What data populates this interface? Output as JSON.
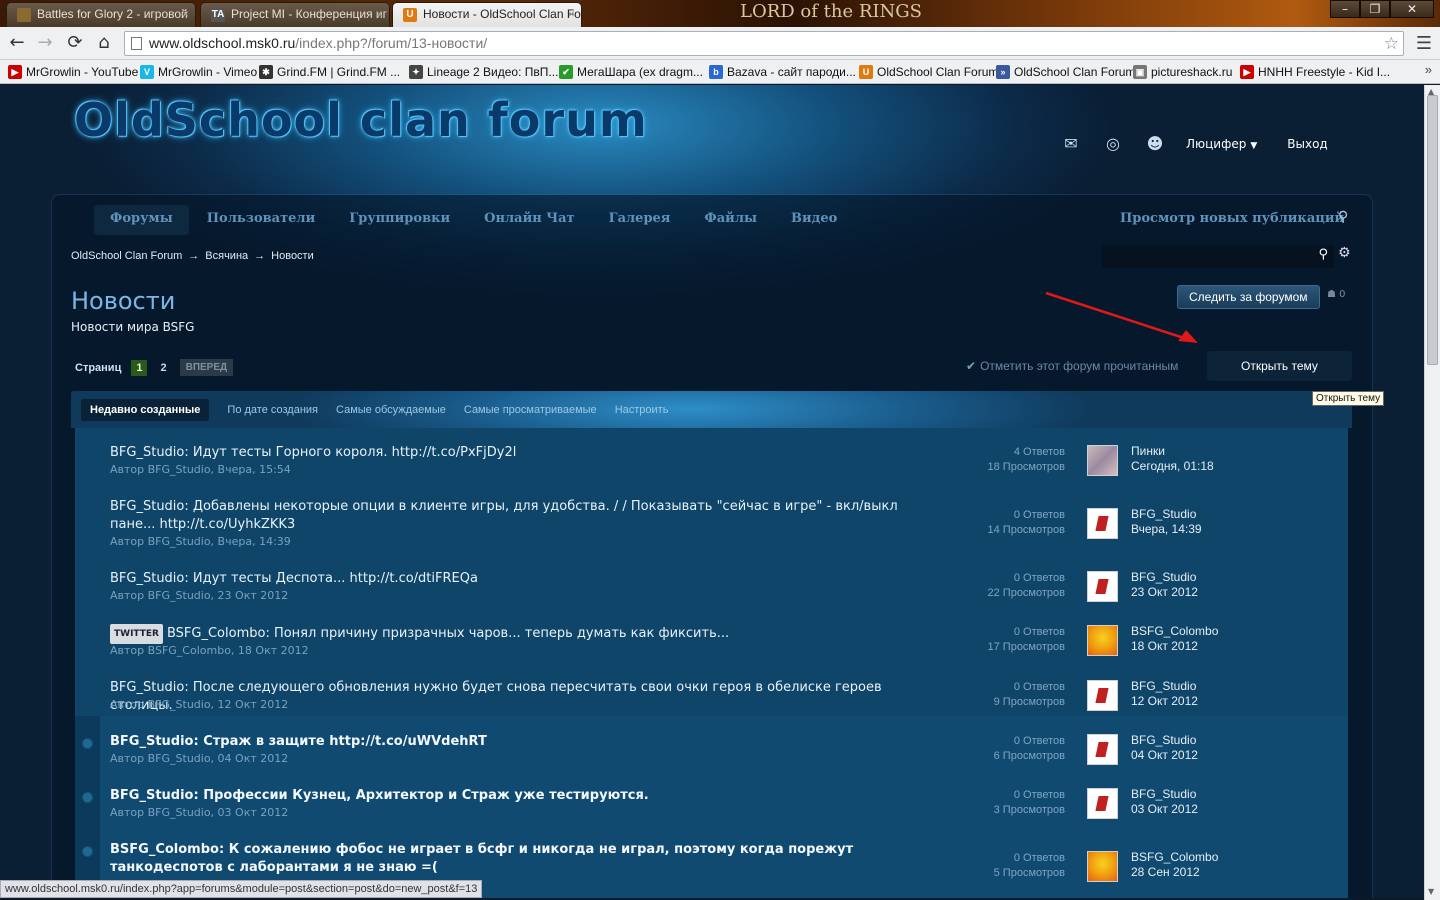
{
  "browser": {
    "tabs": [
      {
        "label": "Battles for Glory 2 - игровой",
        "icon_color": "#8a6a30",
        "active": false
      },
      {
        "label": "Project MI - Конференция иг",
        "icon_color": "#555555",
        "active": false
      },
      {
        "label": "Новости - OldSchool Clan For",
        "icon_color": "#e07a10",
        "active": true
      }
    ],
    "tab_icon_text": [
      "",
      "TA",
      "U"
    ],
    "theme_text": "LORD of the RINGS",
    "url_host": "www.oldschool.msk0.ru",
    "url_path": "/index.php?/forum/13-новости/",
    "bookmarks": [
      {
        "label": "MrGrowlin - YouTube",
        "icon": "youtube-icon",
        "color": "#cc0000"
      },
      {
        "label": "MrGrowlin - Vimeo",
        "icon": "vimeo-icon",
        "color": "#1ab7ea"
      },
      {
        "label": "Grind.FM | Grind.FM ...",
        "icon": "paw-icon",
        "color": "#333333"
      },
      {
        "label": "Lineage 2 Видео: ПвП...",
        "icon": "lineage-icon",
        "color": "#444444"
      },
      {
        "label": "МегаШара (ex dragm...",
        "icon": "check-icon",
        "color": "#2a9a2a"
      },
      {
        "label": "Bazava - сайт пароди...",
        "icon": "bazava-icon",
        "color": "#2a6ad0"
      },
      {
        "label": "OldSchool Clan Forum",
        "icon": "oldschool-icon",
        "color": "#e07a10"
      },
      {
        "label": "OldSchool Clan Forum",
        "icon": "double-arrow-icon",
        "color": "#3a5aa0"
      },
      {
        "label": "pictureshack.ru",
        "icon": "picture-icon",
        "color": "#777777"
      },
      {
        "label": "HNHH Freestyle - Kid I...",
        "icon": "youtube-icon",
        "color": "#cc0000"
      }
    ],
    "status_url": "www.oldschool.msk0.ru/index.php?app=forums&module=post&section=post&do=new_post&f=13"
  },
  "site": {
    "logo": "OldSchool clan forum",
    "user_name": "Люцифер",
    "logout": "Выход",
    "nav": [
      "Форумы",
      "Пользователи",
      "Группировки",
      "Онлайн Чат",
      "Галерея",
      "Файлы",
      "Видео"
    ],
    "new_publications": "Просмотр новых публикаций",
    "breadcrumb": [
      "OldSchool Clan Forum",
      "Всячина",
      "Новости"
    ],
    "breadcrumb_sep": "→"
  },
  "forum": {
    "title": "Новости",
    "description": "Новости мира BSFG",
    "follow_button": "Следить за форумом",
    "followers": "0",
    "pager_label": "Страниц",
    "pages": [
      "1",
      "2"
    ],
    "next_label": "ВПЕРЕД",
    "mark_read": "Отметить этот форум прочитанным",
    "new_topic": "Открыть тему",
    "tooltip": "Открыть тему",
    "sort_tabs": [
      "Недавно созданные",
      "По дате создания",
      "Самые обсуждаемые",
      "Самые просматриваемые",
      "Настроить"
    ]
  },
  "topics": [
    {
      "title": "BFG_Studio: Идут тесты Горного короля. http://t.co/PxFjDy2l",
      "tag": "",
      "meta": "Автор BFG_Studio, Вчера, 15:54",
      "replies": "4 Ответов",
      "views": "18 Просмотров",
      "last_by": "Пинки",
      "last_date": "Сегодня, 01:18",
      "avatar": "pinki",
      "unread": false
    },
    {
      "title": "BFG_Studio: Добавлены некоторые опции в клиенте игры, для удобства. / / Показывать \"сейчас в игре\" - вкл/выкл пане... http://t.co/UyhkZKK3",
      "tag": "",
      "meta": "Автор BFG_Studio, Вчера, 14:39",
      "replies": "0 Ответов",
      "views": "14 Просмотров",
      "last_by": "BFG_Studio",
      "last_date": "Вчера, 14:39",
      "avatar": "bfg",
      "unread": false
    },
    {
      "title": "BFG_Studio: Идут тесты Деспота... http://t.co/dtiFREQa",
      "tag": "",
      "meta": "Автор BFG_Studio, 23 Окт 2012",
      "replies": "0 Ответов",
      "views": "22 Просмотров",
      "last_by": "BFG_Studio",
      "last_date": "23 Окт 2012",
      "avatar": "bfg",
      "unread": false
    },
    {
      "title": "BSFG_Colombo: Понял причину призрачных чаров... теперь думать как фиксить...",
      "tag": "TWITTER",
      "meta": "Автор BSFG_Colombo, 18 Окт 2012",
      "replies": "0 Ответов",
      "views": "17 Просмотров",
      "last_by": "BSFG_Colombo",
      "last_date": "18 Окт 2012",
      "avatar": "colombo",
      "unread": false
    },
    {
      "title": "BFG_Studio: После следующего обновления нужно будет снова пересчитать свои очки героя в обелиске героев столицы.",
      "tag": "",
      "meta": "Автор BFG_Studio, 12 Окт 2012",
      "replies": "0 Ответов",
      "views": "9 Просмотров",
      "last_by": "BFG_Studio",
      "last_date": "12 Окт 2012",
      "avatar": "bfg",
      "unread": false
    },
    {
      "title": "BFG_Studio: Страж в защите http://t.co/uWVdehRT",
      "tag": "",
      "meta": "Автор BFG_Studio, 04 Окт 2012",
      "replies": "0 Ответов",
      "views": "6 Просмотров",
      "last_by": "BFG_Studio",
      "last_date": "04 Окт 2012",
      "avatar": "bfg",
      "unread": true
    },
    {
      "title": "BFG_Studio: Профессии Кузнец, Архитектор и Страж уже тестируются.",
      "tag": "",
      "meta": "Автор BFG_Studio, 03 Окт 2012",
      "replies": "0 Ответов",
      "views": "3 Просмотров",
      "last_by": "BFG_Studio",
      "last_date": "03 Окт 2012",
      "avatar": "bfg",
      "unread": true
    },
    {
      "title": "BSFG_Colombo: К сожалению фобос не играет в бсфг и никогда не играл, поэтому когда порежут танкодеспотов с лаборантами я не знаю =(",
      "tag": "",
      "meta": "",
      "replies": "0 Ответов",
      "views": "5 Просмотров",
      "last_by": "BSFG_Colombo",
      "last_date": "28 Сен 2012",
      "avatar": "colombo",
      "unread": true
    }
  ]
}
